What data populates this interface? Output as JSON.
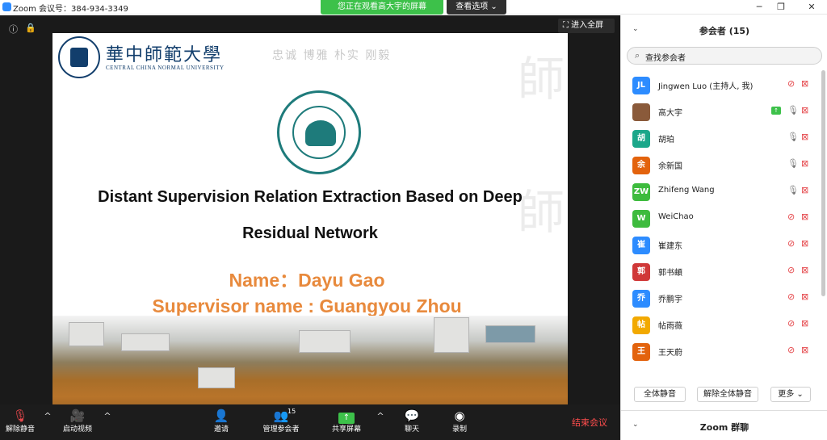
{
  "window": {
    "title": "Zoom 会议号：384-934-3349",
    "minimize": "─",
    "restore": "❐",
    "close": "✕"
  },
  "banner": {
    "sharing_text": "您正在观看高大宇的屏幕",
    "view_options": "查看选项 ⌄"
  },
  "stage": {
    "info_icon": "ⓘ",
    "lock_icon": "🔒",
    "fullscreen_label": "⛶ 进入全屏"
  },
  "slide": {
    "university_cn": "華中師範大學",
    "university_en": "CENTRAL CHINA NORMAL UNIVERSITY",
    "motto": "忠诚 博雅 朴实 刚毅",
    "title_line1": "Distant Supervision Relation Extraction Based on Deep",
    "title_line2": "Residual Network",
    "name_line": "Name：Dayu Gao",
    "supervisor_line": "Supervisor name : Guangyou Zhou"
  },
  "toolbar": {
    "unmute": "解除静音",
    "start_video": "启动视频",
    "invite": "邀请",
    "manage_participants": "管理参会者",
    "participant_count": "15",
    "share_screen": "共享屏幕",
    "chat": "聊天",
    "record": "录制",
    "end_meeting": "结束会议",
    "caret": "^"
  },
  "panel": {
    "title": "参会者 (15)",
    "chevron": "⌄",
    "search_placeholder": "查找参会者",
    "participants": [
      {
        "initials": "JL",
        "name": "Jingwen Luo (主持人, 我)",
        "color": "#2d8cff",
        "muted": true,
        "sharing": false
      },
      {
        "initials": "",
        "name": "高大宇",
        "color": "#8a5a3a",
        "muted": false,
        "sharing": true
      },
      {
        "initials": "胡",
        "name": "胡珀",
        "color": "#1ba78a",
        "muted": false,
        "sharing": false
      },
      {
        "initials": "余",
        "name": "余新国",
        "color": "#e3630d",
        "muted": false,
        "sharing": false
      },
      {
        "initials": "ZW",
        "name": "Zhifeng Wang",
        "color": "#3dbb3d",
        "muted": false,
        "sharing": false
      },
      {
        "initials": "W",
        "name": "WeiChao",
        "color": "#3dbb3d",
        "muted": true,
        "sharing": false
      },
      {
        "initials": "崔",
        "name": "崔建东",
        "color": "#2d8cff",
        "muted": true,
        "sharing": false
      },
      {
        "initials": "郭",
        "name": "郭书頔",
        "color": "#d03838",
        "muted": true,
        "sharing": false
      },
      {
        "initials": "乔",
        "name": "乔鹏宇",
        "color": "#2d8cff",
        "muted": true,
        "sharing": false
      },
      {
        "initials": "帖",
        "name": "帖雨薇",
        "color": "#f2a900",
        "muted": true,
        "sharing": false
      },
      {
        "initials": "王",
        "name": "王天蔚",
        "color": "#e3630d",
        "muted": true,
        "sharing": false
      }
    ],
    "mute_all": "全体静音",
    "unmute_all": "解除全体静音",
    "more": "更多 ⌄",
    "chat_title": "Zoom 群聊"
  }
}
